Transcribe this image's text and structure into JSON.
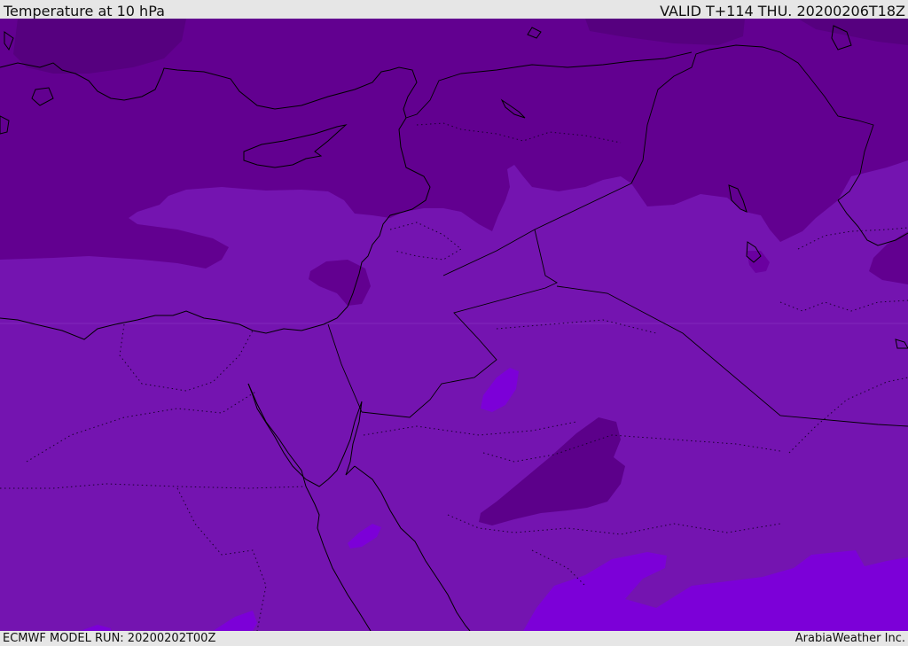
{
  "header": {
    "title": "Temperature at 10 hPa",
    "valid_time": "VALID T+114 THU. 20200206T18Z"
  },
  "footer": {
    "model_run": "ECMWF MODEL RUN: 20200202T00Z",
    "credit": "ArabiaWeather Inc."
  },
  "map": {
    "variable": "temperature",
    "level": "10 hPa",
    "shading_colors": {
      "darkest": "#56007f",
      "dark": "#620090",
      "mid": "#7414b0",
      "bright": "#7c00d8"
    },
    "coastline_color": "#000000"
  }
}
